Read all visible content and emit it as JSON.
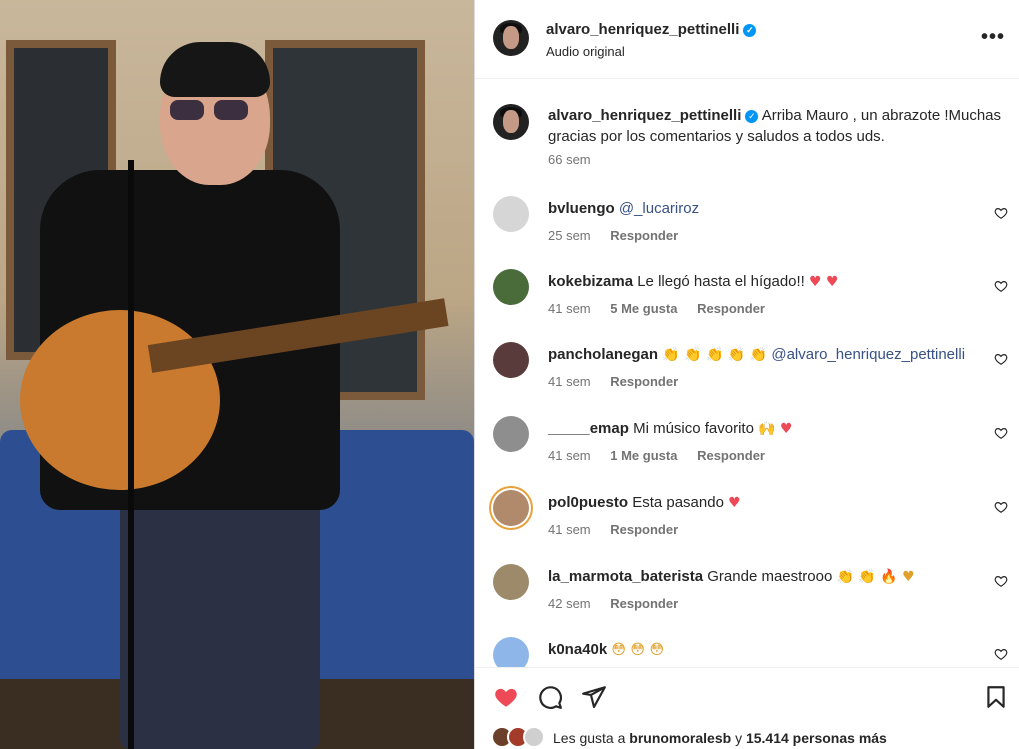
{
  "post": {
    "username": "alvaro_henriquez_pettinelli",
    "audio": "Audio original",
    "more_label": "•••"
  },
  "caption": {
    "username": "alvaro_henriquez_pettinelli",
    "text": "Arriba Mauro , un abrazote !Muchas gracias por los comentarios y saludos a todos uds.",
    "time": "66 sem"
  },
  "comments": [
    {
      "user": "bvluengo",
      "text": "",
      "mention": "@_lucariroz",
      "emoji": "",
      "time": "25 sem",
      "likes": "",
      "reply": "Responder",
      "avatar_color": "#d6d6d6"
    },
    {
      "user": "kokebizama",
      "text": "Le llegó hasta el hígado!!",
      "mention": "",
      "emoji": "♥ ♥",
      "time": "41 sem",
      "likes": "5 Me gusta",
      "reply": "Responder",
      "avatar_color": "#4a6b3a"
    },
    {
      "user": "pancholanegan",
      "text": "",
      "mention": "@alvaro_henriquez_pettinelli",
      "emoji": "👏 👏 👏 👏 👏",
      "time": "41 sem",
      "likes": "",
      "reply": "Responder",
      "avatar_color": "#5a3b3b"
    },
    {
      "user": "_____emap",
      "text": "Mi músico favorito",
      "mention": "",
      "emoji": "🙌 ♥",
      "time": "41 sem",
      "likes": "1 Me gusta",
      "reply": "Responder",
      "avatar_color": "#8e8e8e"
    },
    {
      "user": "pol0puesto",
      "text": "Esta pasando",
      "mention": "",
      "emoji": "♥",
      "time": "41 sem",
      "likes": "",
      "reply": "Responder",
      "avatar_color": "#b08a6b"
    },
    {
      "user": "la_marmota_baterista",
      "text": "Grande maestrooo",
      "mention": "",
      "emoji": "👏 👏 🔥 ♥",
      "time": "42 sem",
      "likes": "",
      "reply": "Responder",
      "avatar_color": "#9c8a6a"
    },
    {
      "user": "k0na40k",
      "text": "",
      "mention": "",
      "emoji": "😳 😳 😳",
      "time": "",
      "likes": "",
      "reply": "",
      "avatar_color": "#8fb6e8"
    }
  ],
  "likes_line": {
    "prefix": "Les gusta a",
    "user": "brunomoralesb",
    "middle": "y",
    "count": "15.414 personas más"
  },
  "colors": {
    "heart_liked": "#ed4956",
    "mention": "#385185",
    "verified": "#0095f6"
  },
  "icons": [
    "heart-icon",
    "comment-icon",
    "share-icon",
    "bookmark-icon",
    "more-icon",
    "verified-icon"
  ]
}
